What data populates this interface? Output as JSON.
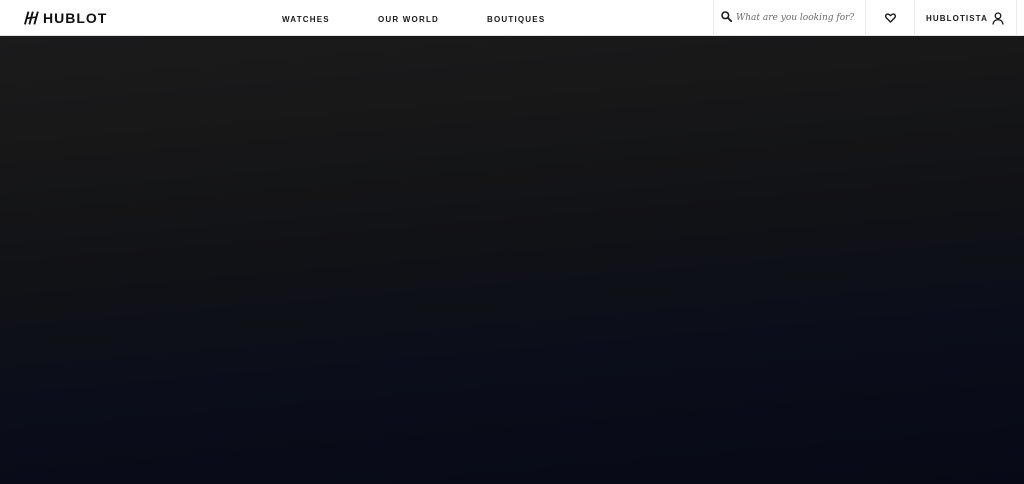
{
  "brand": {
    "name": "HUBLOT",
    "logo_icon": "hublot-h-mark"
  },
  "nav": {
    "items": [
      {
        "label": "WATCHES"
      },
      {
        "label": "OUR WORLD"
      },
      {
        "label": "BOUTIQUES"
      }
    ]
  },
  "search": {
    "icon": "search-icon",
    "placeholder": "What are you looking for?",
    "value": ""
  },
  "wishlist": {
    "icon": "heart-icon"
  },
  "account": {
    "label": "HUBLOTISTA",
    "icon": "user-icon"
  },
  "colors": {
    "header_bg": "#ffffff",
    "text": "#1a1a1a",
    "hero_top": "#1b1b1c",
    "hero_bottom": "#070a16"
  }
}
